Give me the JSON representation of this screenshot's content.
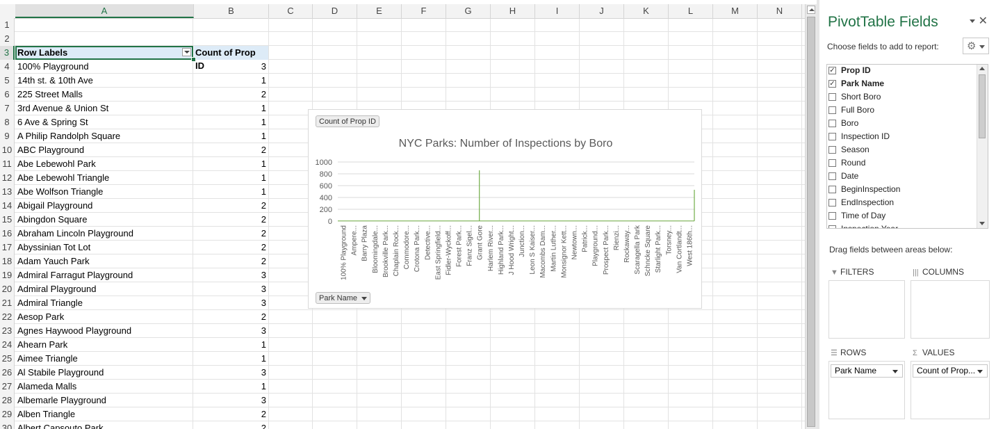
{
  "columns": [
    "A",
    "B",
    "C",
    "D",
    "E",
    "F",
    "G",
    "H",
    "I",
    "J",
    "K",
    "L",
    "M",
    "N"
  ],
  "row_numbers": [
    "1",
    "2",
    "3",
    "4",
    "5",
    "6",
    "7",
    "8",
    "9",
    "10",
    "11",
    "12",
    "13",
    "14",
    "15",
    "16",
    "17",
    "18",
    "19",
    "20",
    "21",
    "22",
    "23",
    "24",
    "25",
    "26",
    "27",
    "28",
    "29",
    "30"
  ],
  "pivot": {
    "header_row": "Row Labels",
    "header_value": "Count of Prop ID",
    "rows": [
      [
        "100% Playground",
        "3"
      ],
      [
        "14th st. & 10th Ave",
        "1"
      ],
      [
        "225 Street Malls",
        "2"
      ],
      [
        "3rd Avenue & Union St",
        "1"
      ],
      [
        "6 Ave & Spring St",
        "1"
      ],
      [
        "A Philip Randolph Square",
        "1"
      ],
      [
        "ABC Playground",
        "2"
      ],
      [
        "Abe Lebewohl Park",
        "1"
      ],
      [
        "Abe Lebewohl Triangle",
        "1"
      ],
      [
        "Abe Wolfson Triangle",
        "1"
      ],
      [
        "Abigail Playground",
        "2"
      ],
      [
        "Abingdon Square",
        "2"
      ],
      [
        "Abraham Lincoln Playground",
        "2"
      ],
      [
        "Abyssinian Tot Lot",
        "2"
      ],
      [
        "Adam Yauch Park",
        "2"
      ],
      [
        "Admiral Farragut Playground",
        "3"
      ],
      [
        "Admiral Playground",
        "3"
      ],
      [
        "Admiral Triangle",
        "3"
      ],
      [
        "Aesop Park",
        "2"
      ],
      [
        "Agnes Haywood Playground",
        "3"
      ],
      [
        "Ahearn Park",
        "1"
      ],
      [
        "Aimee Triangle",
        "1"
      ],
      [
        "Al Stabile Playground",
        "3"
      ],
      [
        "Alameda Malls",
        "1"
      ],
      [
        "Albemarle Playground",
        "3"
      ],
      [
        "Alben Triangle",
        "2"
      ],
      [
        "Albert Capsouto Park",
        "2"
      ]
    ]
  },
  "chart": {
    "value_button": "Count of Prop ID",
    "axis_button": "Park Name",
    "colors": {
      "line": "#70ad47",
      "grid": "#d9d9d9",
      "text": "#595959"
    }
  },
  "chart_data": {
    "type": "line",
    "title": "NYC Parks: Number of Inspections by Boro",
    "ylim": [
      0,
      1000
    ],
    "yticks": [
      "1000",
      "800",
      "600",
      "400",
      "200",
      "0"
    ],
    "categories": [
      "100% Playground",
      "Ampere...",
      "Barry Plaza",
      "Bloomingdale...",
      "Brookville Park...",
      "Chaplain Rock...",
      "Commodore...",
      "Crotona Park...",
      "Detective...",
      "East Springfield...",
      "Fidler-Wyckoff...",
      "Forest Park...",
      "Franz Sigel...",
      "Grant Gore",
      "Harlem River...",
      "Highland Park...",
      "J Hood Wright...",
      "Junction...",
      "Leon S Kaiser...",
      "Macombs Dam...",
      "Martin Luther...",
      "Monsignor Kett...",
      "Newtown...",
      "Patrick...",
      "Playground...",
      "Prospect Park...",
      "Rienzi...",
      "Rockaway...",
      "Scaragella Park",
      "Schncke Square",
      "Starlight Park...",
      "Torsney...",
      "Van Cortlandt...",
      "West 186th..."
    ],
    "series": [
      {
        "name": "",
        "spikes": [
          {
            "category": "Grant Gore",
            "value": 860
          },
          {
            "category": "West 186th...",
            "value": 530
          }
        ],
        "baseline": 3
      }
    ],
    "grid": true,
    "legend": "none"
  },
  "pane": {
    "title": "PivotTable Fields",
    "choose": "Choose fields to add to report:",
    "fields": [
      {
        "label": "Prop ID",
        "checked": true
      },
      {
        "label": "Park Name",
        "checked": true
      },
      {
        "label": "Short Boro",
        "checked": false
      },
      {
        "label": "Full Boro",
        "checked": false
      },
      {
        "label": "Boro",
        "checked": false
      },
      {
        "label": "Inspection ID",
        "checked": false
      },
      {
        "label": "Season",
        "checked": false
      },
      {
        "label": "Round",
        "checked": false
      },
      {
        "label": "Date",
        "checked": false
      },
      {
        "label": "BeginInspection",
        "checked": false
      },
      {
        "label": "EndInspection",
        "checked": false
      },
      {
        "label": "Time of Day",
        "checked": false
      },
      {
        "label": "Inspection Year",
        "checked": false
      }
    ],
    "drag": "Drag fields between areas below:",
    "filters": "FILTERS",
    "columns": "COLUMNS",
    "rows": "ROWS",
    "values": "VALUES",
    "rows_chip": "Park Name",
    "values_chip": "Count of Prop..."
  }
}
